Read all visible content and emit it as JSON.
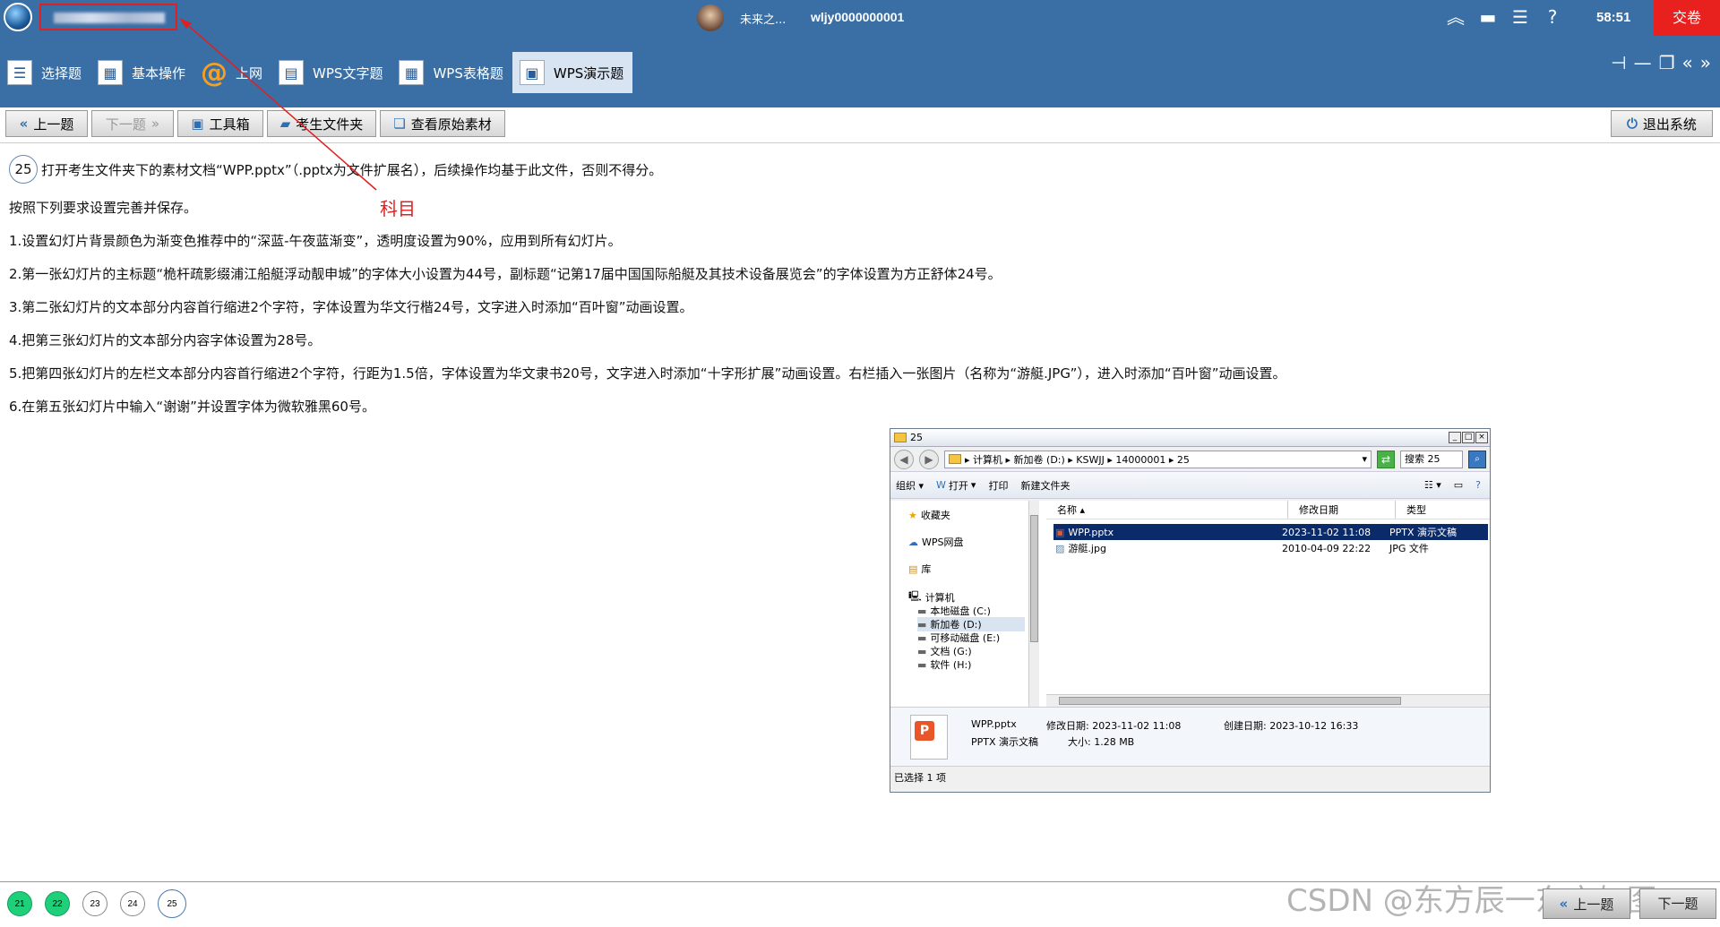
{
  "header": {
    "user_name": "未来之...",
    "user_id": "wljy0000000001",
    "timer": "58:51",
    "submit_label": "交卷"
  },
  "question_types": [
    {
      "label": "选择题",
      "icon": "list-icon"
    },
    {
      "label": "基本操作",
      "icon": "grid-icon"
    },
    {
      "label": "上网",
      "icon": "at-icon"
    },
    {
      "label": "WPS文字题",
      "icon": "document-icon"
    },
    {
      "label": "WPS表格题",
      "icon": "spreadsheet-icon"
    },
    {
      "label": "WPS演示题",
      "icon": "presentation-icon",
      "active": true
    }
  ],
  "toolbar": {
    "prev_label": "上一题",
    "next_label": "下一题",
    "toolbox_label": "工具箱",
    "student_folder_label": "考生文件夹",
    "view_source_label": "查看原始素材",
    "exit_label": "退出系统"
  },
  "question": {
    "number": "25",
    "intro": "打开考生文件夹下的素材文档“WPP.pptx”（.pptx为文件扩展名），后续操作均基于此文件，否则不得分。",
    "requirement": "按照下列要求设置完善并保存。",
    "items": [
      "1.设置幻灯片背景颜色为渐变色推荐中的“深蓝-午夜蓝渐变”，透明度设置为90%，应用到所有幻灯片。",
      "2.第一张幻灯片的主标题“桅杆疏影缀浦江船艇浮动靓申城”的字体大小设置为44号，副标题“记第17届中国国际船艇及其技术设备展览会”的字体设置为方正舒体24号。",
      "3.第二张幻灯片的文本部分内容首行缩进2个字符，字体设置为华文行楷24号，文字进入时添加“百叶窗”动画设置。",
      "4.把第三张幻灯片的文本部分内容字体设置为28号。",
      "5.把第四张幻灯片的左栏文本部分内容首行缩进2个字符，行距为1.5倍，字体设置为华文隶书20号，文字进入时添加“十字形扩展”动画设置。右栏插入一张图片（名称为“游艇.JPG”），进入时添加“百叶窗”动画设置。",
      "6.在第五张幻灯片中输入“谢谢”并设置字体为微软雅黑60号。"
    ]
  },
  "annotation": {
    "label": "科目",
    "color": "#e02020"
  },
  "explorer": {
    "title": "25",
    "address": "▸ 计算机 ▸ 新加卷 (D:) ▸ KSWJJ ▸ 14000001 ▸ 25",
    "search_placeholder": "搜索 25",
    "tools": {
      "organize": "组织 ▾",
      "open": "打开",
      "print": "打印",
      "new_folder": "新建文件夹"
    },
    "nav": {
      "favorites": "收藏夹",
      "wps_cloud": "WPS网盘",
      "libraries": "库",
      "computer": "计算机",
      "drives": [
        "本地磁盘 (C:)",
        "新加卷 (D:)",
        "可移动磁盘 (E:)",
        "文档 (G:)",
        "软件 (H:)"
      ]
    },
    "columns": [
      "名称",
      "修改日期",
      "类型"
    ],
    "files": [
      {
        "name": "WPP.pptx",
        "date": "2023-11-02 11:08",
        "type": "PPTX 演示文稿",
        "selected": true
      },
      {
        "name": "游艇.jpg",
        "date": "2010-04-09 22:22",
        "type": "JPG 文件",
        "selected": false
      }
    ],
    "detail": {
      "file_name": "WPP.pptx",
      "file_type": "PPTX 演示文稿",
      "modified": "修改日期: 2023-11-02 11:08",
      "created": "创建日期: 2023-10-12 16:33",
      "size": "大小: 1.28 MB"
    },
    "status": "已选择 1 项"
  },
  "question_nav": [
    {
      "num": "21",
      "state": "done"
    },
    {
      "num": "22",
      "state": "done"
    },
    {
      "num": "23",
      "state": "todo"
    },
    {
      "num": "24",
      "state": "todo"
    },
    {
      "num": "25",
      "state": "current"
    }
  ],
  "footer": {
    "prev_label": "上一题",
    "next_label": "下一题",
    "watermark": "CSDN @东方辰一东方如图"
  }
}
